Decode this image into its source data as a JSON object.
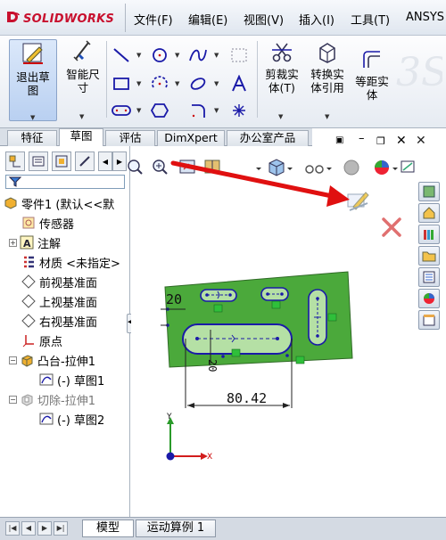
{
  "app": {
    "logo_text": "SOLIDWORKS",
    "logo_mark": "3S"
  },
  "menu": [
    {
      "label": "文件(F)"
    },
    {
      "label": "编辑(E)"
    },
    {
      "label": "视图(V)"
    },
    {
      "label": "插入(I)"
    },
    {
      "label": "工具(T)"
    },
    {
      "label": "ANSYS"
    }
  ],
  "ribbon": {
    "exit_sketch": "退出草\n图",
    "smart_dim": "智能尺\n寸",
    "trim": "剪裁实\n体(T)",
    "convert": "转换实\n体引用",
    "offset": "等距实\n体"
  },
  "command_tabs": [
    {
      "label": "特征"
    },
    {
      "label": "草图"
    },
    {
      "label": "评估"
    },
    {
      "label": "DimXpert"
    },
    {
      "label": "办公室产品"
    }
  ],
  "active_command_tab": "草图",
  "tree": {
    "items": [
      {
        "label": "零件1 (默认<<默",
        "icon": "part-icon"
      },
      {
        "label": "传感器",
        "icon": "sensor-icon"
      },
      {
        "label": "注解",
        "icon": "annotation-icon"
      },
      {
        "label": "材质 <未指定>",
        "icon": "material-icon"
      },
      {
        "label": "前视基准面",
        "icon": "plane-icon"
      },
      {
        "label": "上视基准面",
        "icon": "plane-icon"
      },
      {
        "label": "右视基准面",
        "icon": "plane-icon"
      },
      {
        "label": "原点",
        "icon": "origin-icon"
      },
      {
        "label": "凸台-拉伸1",
        "icon": "extrude-icon"
      },
      {
        "label": "(-) 草图1",
        "icon": "sketch-icon"
      },
      {
        "label": "切除-拉伸1",
        "icon": "cut-extrude-icon"
      },
      {
        "label": "(-) 草图2",
        "icon": "sketch-icon"
      }
    ]
  },
  "sketch": {
    "dim_horizontal": "80.42",
    "dim_left": "20",
    "dim_inner": "20",
    "axis_x": "X",
    "axis_y": "Y"
  },
  "bottom_tabs": [
    {
      "label": "模型"
    },
    {
      "label": "运动算例 1"
    }
  ],
  "colors": {
    "plate": "#4ba93b",
    "sketch_line": "#1a1aa8",
    "arrow": "#e01010",
    "logo_red": "#c8102e"
  }
}
